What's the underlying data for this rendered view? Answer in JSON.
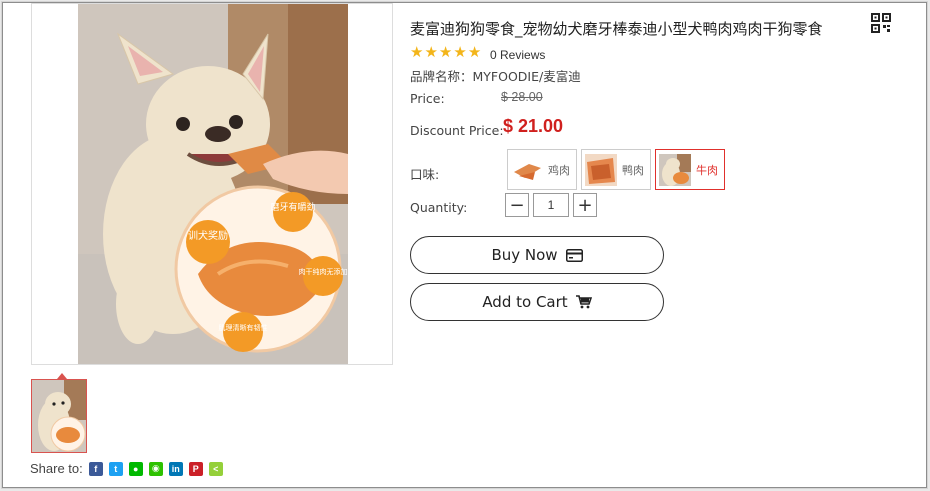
{
  "product": {
    "title": "麦富迪狗狗零食_宠物幼犬磨牙棒泰迪小型犬鸭肉鸡肉干狗零食",
    "rating_stars": 5,
    "reviews": "0 Reviews",
    "brand": "品牌名称：MYFOODIE/麦富迪",
    "price_label": "Price:",
    "price": "$ 28.00",
    "discount_label": "Discount Price:",
    "discount_price": "$ 21.00",
    "flavor_label": "口味:",
    "flavors": [
      "鸡肉",
      "鸭肉",
      "牛肉"
    ],
    "selected_flavor": "牛肉",
    "quantity_label": "Quantity:",
    "quantity": "1",
    "buy_now": "Buy Now",
    "add_to_cart": "Add to Cart",
    "share_label": "Share to:"
  },
  "image_badges": [
    "训犬奖励",
    "磨牙有嚼劲",
    "肉干纯肉无添加",
    "肌理清晰有韧性"
  ],
  "share_icons": [
    "facebook-icon",
    "twitter-icon",
    "line-icon",
    "wechat-icon",
    "linkedin-icon",
    "pinterest-icon",
    "share-icon"
  ],
  "colors": {
    "accent": "#d0201e",
    "star": "#f3b51a"
  }
}
